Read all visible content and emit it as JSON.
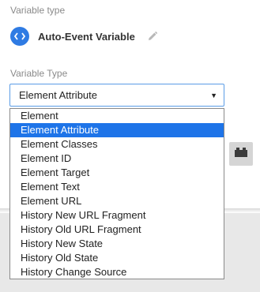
{
  "variable_type_section": {
    "label": "Variable type",
    "type_name": "Auto-Event Variable",
    "type_icon": "code-brackets-icon",
    "edit_icon": "pencil-icon"
  },
  "config_section": {
    "label": "Variable Type",
    "selected_value": "Element Attribute",
    "options": [
      "Element",
      "Element Attribute",
      "Element Classes",
      "Element ID",
      "Element Target",
      "Element Text",
      "Element URL",
      "History New URL Fragment",
      "History Old URL Fragment",
      "History New State",
      "History Old State",
      "History Change Source"
    ],
    "highlighted_option": "Element Attribute",
    "arrow": "▼"
  },
  "side_button": {
    "icon": "building-blocks-icon"
  },
  "colors": {
    "accent": "#2f7be3",
    "highlight": "#1e74e8",
    "background_band": "#e8e8e8"
  }
}
